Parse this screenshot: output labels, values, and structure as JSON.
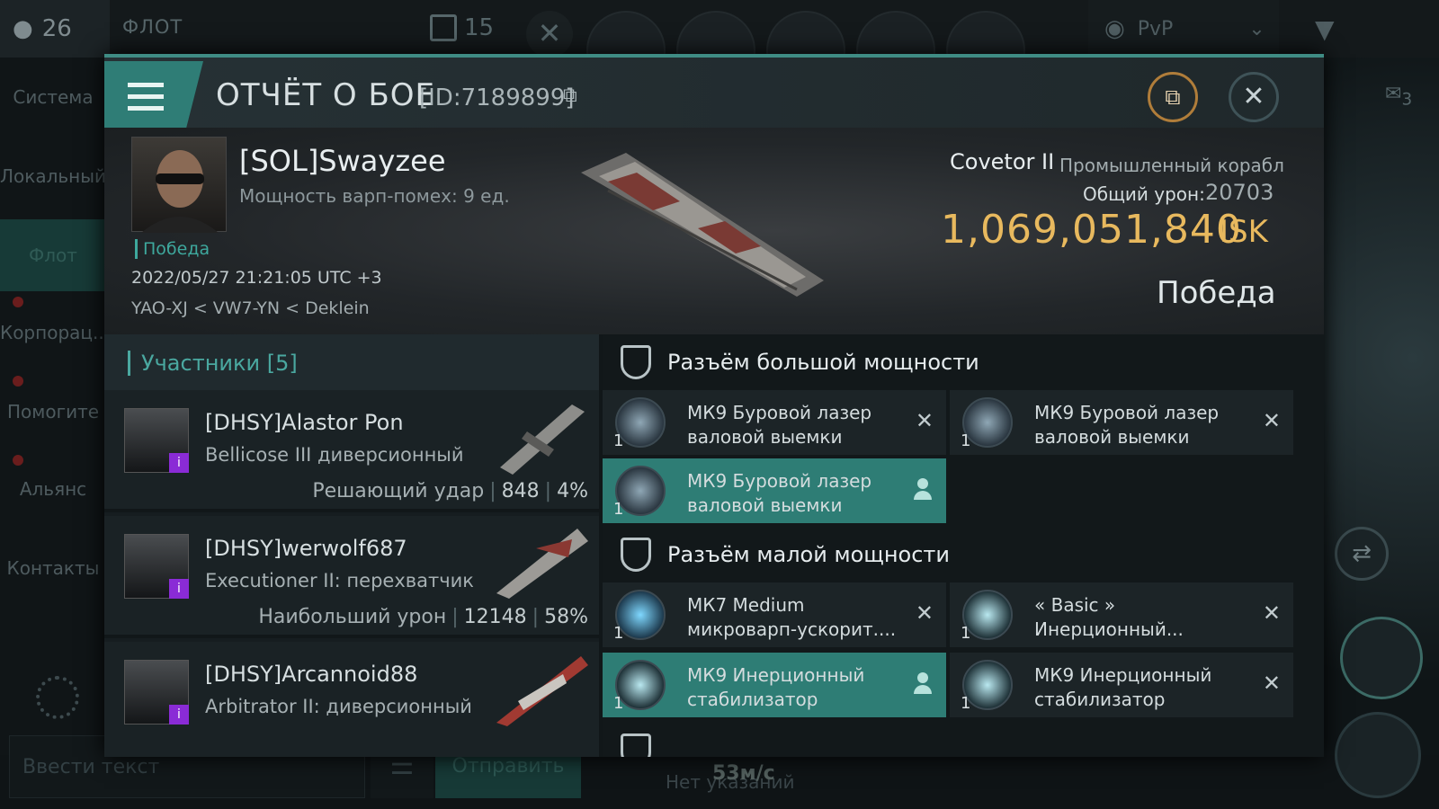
{
  "hud": {
    "pilots_count": "26",
    "fleet_label": "ФЛОТ",
    "members_count": "15",
    "filter_label": "PvP"
  },
  "sidebar": {
    "items": [
      {
        "label": "Система"
      },
      {
        "label": "Локальный"
      },
      {
        "label": "Флот"
      },
      {
        "label": "Корпорац..."
      },
      {
        "label": "Помогите"
      },
      {
        "label": "Альянс"
      },
      {
        "label": "Контакты"
      }
    ]
  },
  "chat": {
    "placeholder": "Ввести текст",
    "send_label": "Отправить",
    "no_orders": "Нет указаний",
    "speed": "53м/с"
  },
  "right_hud": {
    "notif_count": "3"
  },
  "report": {
    "title": "ОТЧЁТ О БОЕ",
    "id": "[ID:7189899]",
    "pilot": {
      "name": "[SOL]Swayzee",
      "warp": "Мощность варп-помех: 9 ед.",
      "status": "Победа",
      "datetime": "2022/05/27 21:21:05 UTC +3",
      "location": "YAO-XJ < VW7-YN < Deklein"
    },
    "ship": {
      "name": "Covetor II",
      "class": "Промышленный корабл",
      "damage_label": "Общий урон:",
      "damage_value": "20703",
      "isk_value": "1,069,051,840",
      "isk_unit": "ISK",
      "result": "Победа"
    }
  },
  "participants": {
    "header": "Участники [5]",
    "rows": [
      {
        "name": "[DHSY]Alastor Pon",
        "ship": "Bellicose III диверсионный",
        "stat_label": "Решающий удар",
        "stat_value": "848",
        "stat_pct": "4%"
      },
      {
        "name": "[DHSY]werwolf687",
        "ship": "Executioner II: перехватчик",
        "stat_label": "Наибольший урон",
        "stat_value": "12148",
        "stat_pct": "58%"
      },
      {
        "name": "[DHSY]Arcannoid88",
        "ship": "Arbitrator II: диверсионный",
        "stat_label": "",
        "stat_value": "",
        "stat_pct": ""
      }
    ]
  },
  "modules": {
    "high_title": "Разъём большой мощности",
    "low_title": "Разъём малой мощности",
    "high": [
      {
        "name_1": "МК9 Буровой лазер",
        "name_2": "валовой выемки",
        "qty": "1",
        "state": "destroyed"
      },
      {
        "name_1": "МК9 Буровой лазер",
        "name_2": "валовой выемки",
        "qty": "1",
        "state": "destroyed"
      },
      {
        "name_1": "МК9 Буровой лазер",
        "name_2": "валовой выемки",
        "qty": "1",
        "state": "dropped"
      }
    ],
    "low": [
      {
        "name_1": "МК7 Medium",
        "name_2": "микроварп-ускорит....",
        "qty": "1",
        "state": "destroyed"
      },
      {
        "name_1": "« Basic »",
        "name_2": "Инерционный...",
        "qty": "1",
        "state": "destroyed"
      },
      {
        "name_1": "МК9 Инерционный",
        "name_2": "стабилизатор",
        "qty": "1",
        "state": "dropped"
      },
      {
        "name_1": "МК9 Инерционный",
        "name_2": "стабилизатор",
        "qty": "1",
        "state": "destroyed"
      }
    ]
  },
  "colors": {
    "accent": "#2e7d75",
    "isk": "#e8b95e",
    "badge": "#8a2bd6"
  }
}
